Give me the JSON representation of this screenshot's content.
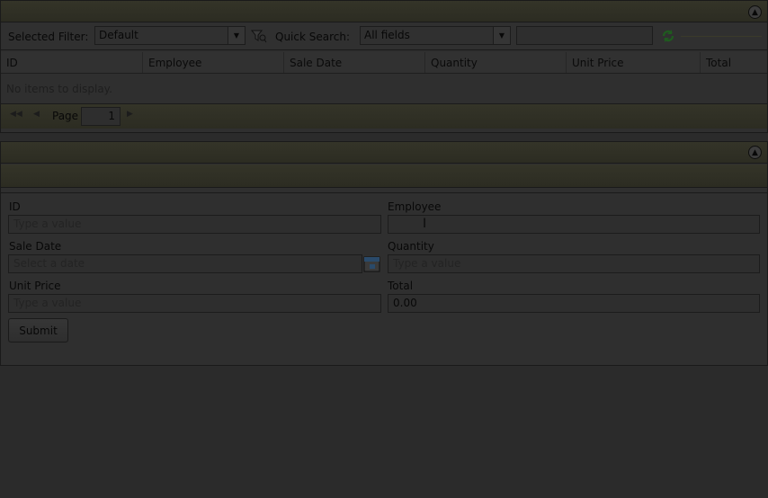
{
  "grid": {
    "filter_label": "Selected Filter:",
    "filter_value": "Default",
    "quick_search_label": "Quick Search:",
    "quick_search_scope": "All fields",
    "search_text": "",
    "columns": [
      "ID",
      "Employee",
      "Sale Date",
      "Quantity",
      "Unit Price",
      "Total"
    ],
    "empty_message": "No items to display.",
    "page_label": "Page",
    "page_value": "1"
  },
  "form": {
    "id_label": "ID",
    "id_placeholder": "Type a value",
    "employee_label": "Employee",
    "employee_value": "",
    "sale_date_label": "Sale Date",
    "sale_date_placeholder": "Select a date",
    "quantity_label": "Quantity",
    "quantity_placeholder": "Type a value",
    "unit_price_label": "Unit Price",
    "unit_price_placeholder": "Type a value",
    "total_label": "Total",
    "total_value": "0.00",
    "submit_label": "Submit"
  },
  "icons": {
    "collapse": "chevron-up-icon",
    "filter": "filter-icon",
    "refresh": "refresh-icon",
    "calendar": "calendar-icon",
    "first_page": "first-page-icon",
    "prev_page": "prev-page-icon",
    "next_page": "next-page-icon"
  },
  "colors": {
    "refresh_accent": "#1f5a1f",
    "calendar_accent": "#2a4a6a"
  }
}
